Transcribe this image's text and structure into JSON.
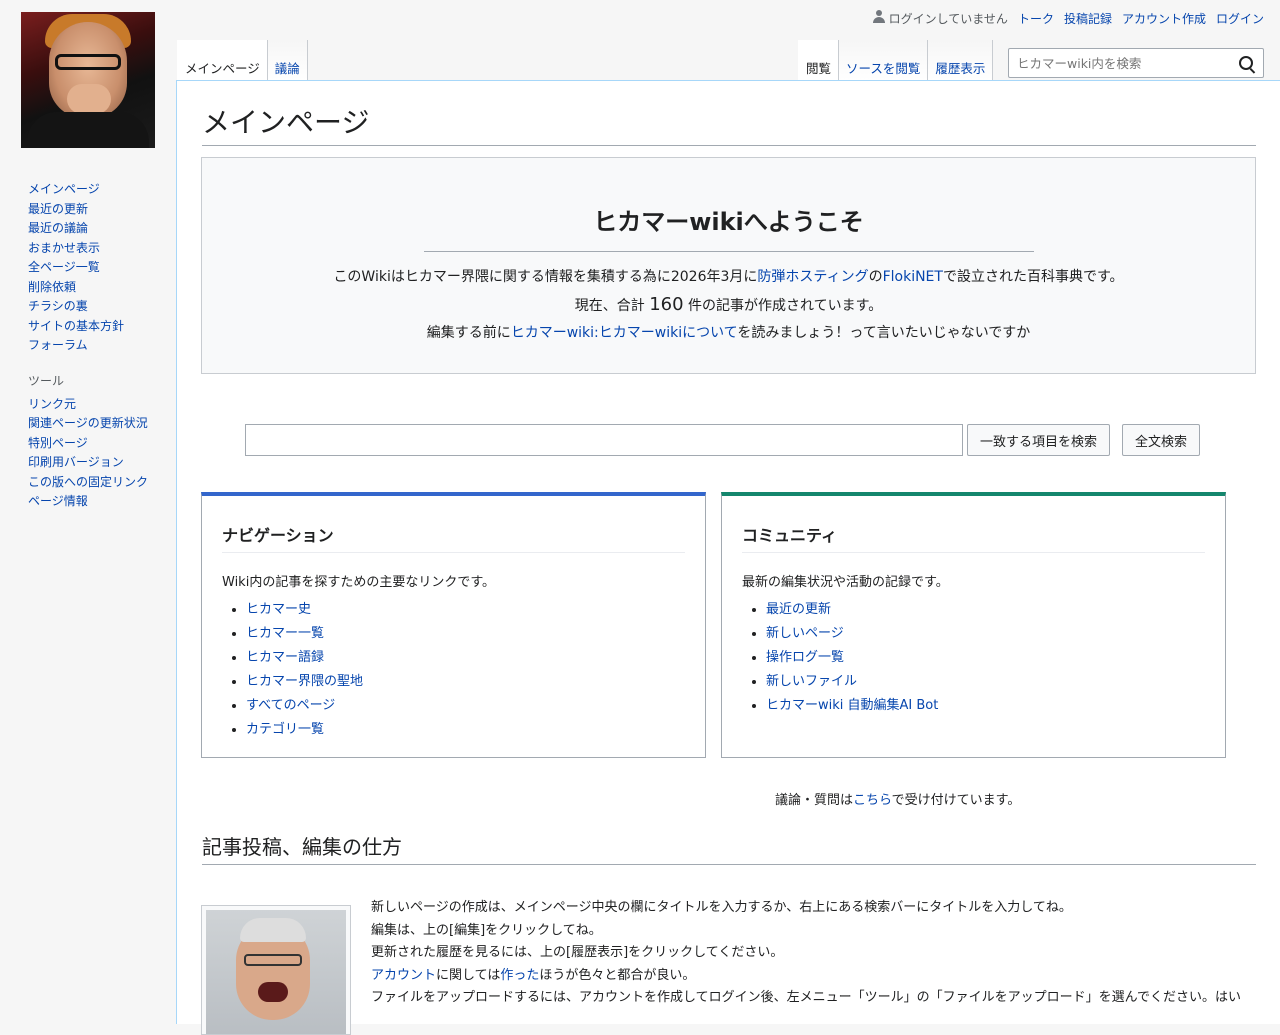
{
  "personal": {
    "not_logged_in": "ログインしていません",
    "talk": "トーク",
    "contributions": "投稿記録",
    "create_account": "アカウント作成",
    "login": "ログイン"
  },
  "tabs": {
    "main_page": "メインページ",
    "discussion": "議論",
    "read": "閲覧",
    "view_source": "ソースを閲覧",
    "history": "履歴表示"
  },
  "search": {
    "placeholder": "ヒカマーwiki内を検索"
  },
  "sidebar": {
    "navigation": [
      "メインページ",
      "最近の更新",
      "最近の議論",
      "おまかせ表示",
      "全ページ一覧",
      "削除依頼",
      "チラシの裏",
      "サイトの基本方針",
      "フォーラム"
    ],
    "tools_heading": "ツール",
    "tools": [
      "リンク元",
      "関連ページの更新状況",
      "特別ページ",
      "印刷用バージョン",
      "この版への固定リンク",
      "ページ情報"
    ]
  },
  "page": {
    "title": "メインページ",
    "welcome": {
      "heading": "ヒカマーwikiへようこそ",
      "line1_pre": "このWikiはヒカマー界隈に関する情報を集積する為に2026年3月に",
      "line1_link1": "防弾ホスティング",
      "line1_mid": "の",
      "line1_link2": "FlokiNET",
      "line1_post": "で設立された百科事典です。",
      "line2_pre": "現在、合計",
      "line2_count": "160",
      "line2_post": "件の記事が作成されています。",
      "line3_pre": "編集する前に",
      "line3_link": "ヒカマーwiki:ヒカマーwikiについて",
      "line3_post": "を読みましょう！って言いたいじゃないですか"
    },
    "search_buttons": {
      "go": "一致する項目を検索",
      "fulltext": "全文検索"
    },
    "navigation_card": {
      "title": "ナビゲーション",
      "desc": "Wiki内の記事を探すための主要なリンクです。",
      "links": [
        "ヒカマー史",
        "ヒカマー一覧",
        "ヒカマー語録",
        "ヒカマー界隈の聖地",
        "すべてのページ",
        "カテゴリ一覧"
      ]
    },
    "community_card": {
      "title": "コミュニティ",
      "desc": "最新の編集状況や活動の記録です。",
      "links": [
        "最近の更新",
        "新しいページ",
        "操作ログ一覧",
        "新しいファイル",
        "ヒカマーwiki 自動編集AI Bot"
      ]
    },
    "discussion_note": {
      "pre": "議論・質問は",
      "link": "こちら",
      "post": "で受け付けています。"
    },
    "section_title": "記事投稿、編集の仕方",
    "howto": {
      "line1": "新しいページの作成は、メインページ中央の欄にタイトルを入力するか、右上にある検索バーにタイトルを入力してね。",
      "line2": "編集は、上の[編集]をクリックしてね。",
      "line3": "更新された履歴を見るには、上の[履歴表示]をクリックしてください。",
      "line4_link1": "アカウント",
      "line4_mid": "に関しては",
      "line4_link2": "作った",
      "line4_post": "ほうが色々と都合が良い。",
      "line5": "ファイルをアップロードするには、アカウントを作成してログイン後、左メニュー「ツール」の「ファイルをアップロード」を選んでください。はい"
    }
  },
  "colors": {
    "link": "#0645ad",
    "nav_accent": "#3366cc",
    "community_accent": "#14866d",
    "content_border": "#a7d7f9"
  }
}
